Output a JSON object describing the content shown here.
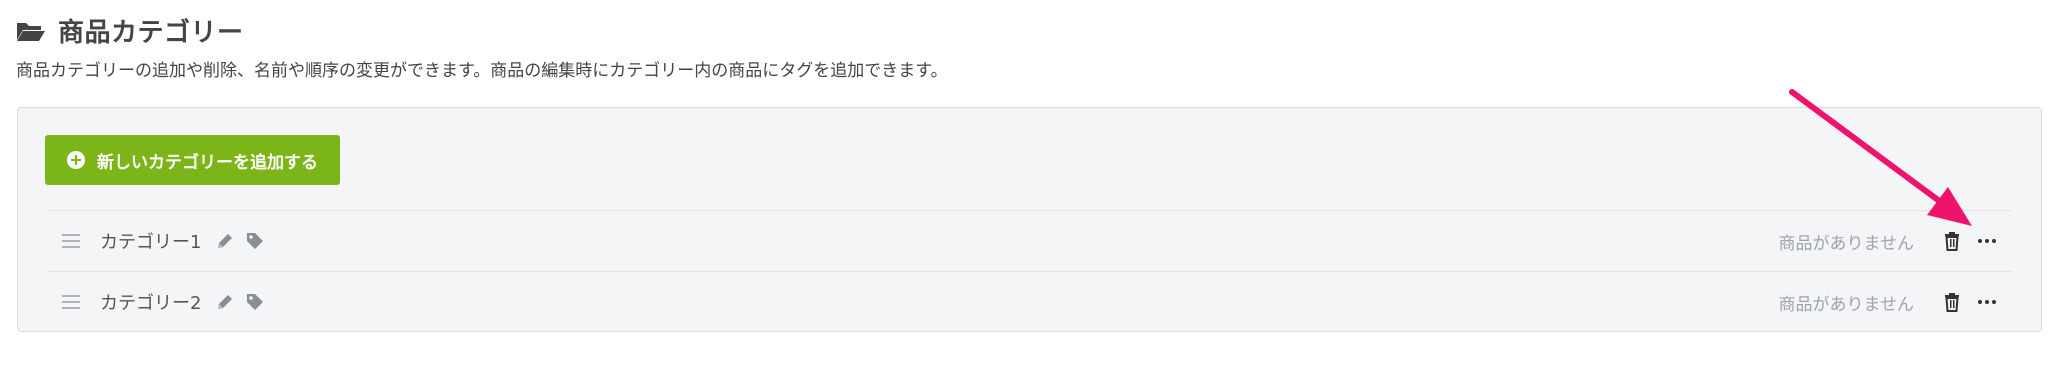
{
  "header": {
    "title": "商品カテゴリー",
    "icon": "folder-open-icon",
    "description": "商品カテゴリーの追加や削除、名前や順序の変更ができます。商品の編集時にカテゴリー内の商品にタグを追加できます。"
  },
  "toolbar": {
    "add_label": "新しいカテゴリーを追加する",
    "add_icon": "plus-circle-icon",
    "accent_color": "#7cb518"
  },
  "categories": [
    {
      "name": "カテゴリー1",
      "status": "商品がありません"
    },
    {
      "name": "カテゴリー2",
      "status": "商品がありません"
    }
  ],
  "annotation": {
    "type": "arrow",
    "color": "#f0136e",
    "points_to": "trash-icon"
  }
}
